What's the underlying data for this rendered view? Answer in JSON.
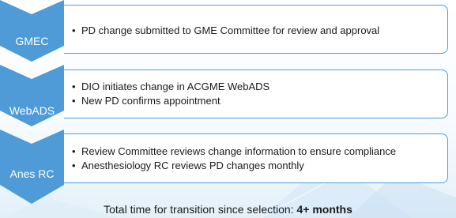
{
  "steps": [
    {
      "label": "GMEC",
      "bullets": [
        "PD change submitted to GME Committee for review and approval"
      ]
    },
    {
      "label": "WebADS",
      "bullets": [
        "DIO initiates change in ACGME WebADS",
        "New PD confirms appointment"
      ]
    },
    {
      "label": "Anes RC",
      "bullets": [
        "Review Committee reviews change information to ensure compliance",
        "Anesthesiology RC reviews PD changes monthly"
      ]
    }
  ],
  "footer": {
    "text": "Total time for transition since selection: ",
    "emphasis": "4+ months"
  },
  "colors": {
    "chevron": "#4e9bd8",
    "box_border": "#4e9bd8"
  }
}
